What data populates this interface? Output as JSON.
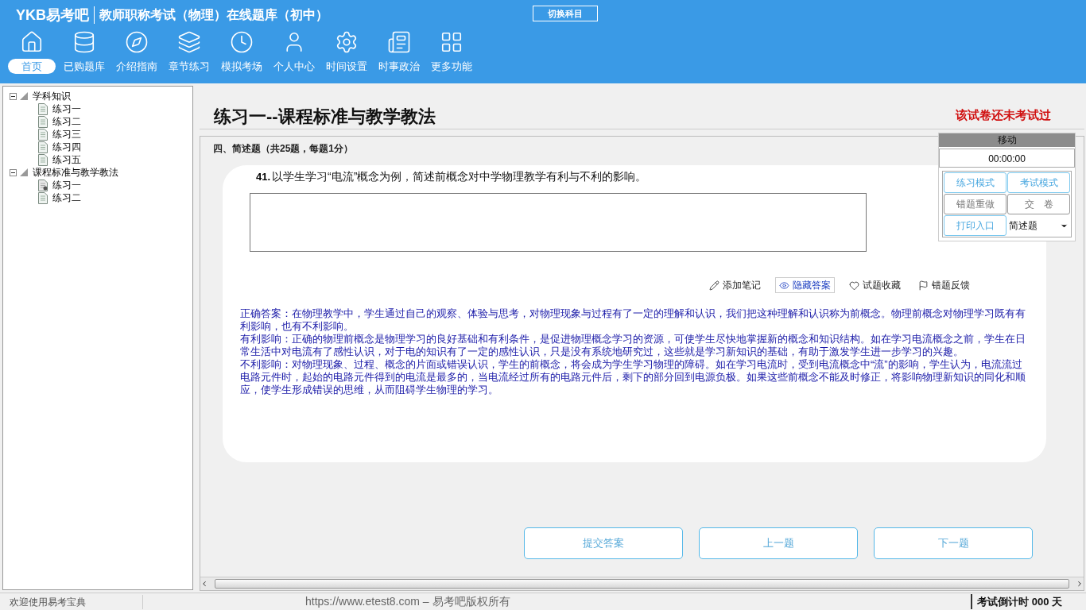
{
  "header": {
    "logo": "YKB易考吧",
    "title": "教师职称考试（物理）在线题库（初中）",
    "switch_button": "切换科目"
  },
  "nav": [
    {
      "label": "首页",
      "kind": "home",
      "selected": true
    },
    {
      "label": "已购题库",
      "kind": "database",
      "selected": false
    },
    {
      "label": "介绍指南",
      "kind": "compass",
      "selected": false
    },
    {
      "label": "章节练习",
      "kind": "layers",
      "selected": false
    },
    {
      "label": "模拟考场",
      "kind": "clock",
      "selected": false
    },
    {
      "label": "个人中心",
      "kind": "user",
      "selected": false
    },
    {
      "label": "时间设置",
      "kind": "settings",
      "selected": false
    },
    {
      "label": "时事政治",
      "kind": "news",
      "selected": false
    },
    {
      "label": "更多功能",
      "kind": "grid",
      "selected": false
    }
  ],
  "tree": [
    {
      "label": "学科知识",
      "expanded": true,
      "children": [
        {
          "label": "练习一",
          "selected": false
        },
        {
          "label": "练习二",
          "selected": false
        },
        {
          "label": "练习三",
          "selected": false
        },
        {
          "label": "练习四",
          "selected": false
        },
        {
          "label": "练习五",
          "selected": false
        }
      ]
    },
    {
      "label": "课程标准与教学教法",
      "expanded": true,
      "children": [
        {
          "label": "练习一",
          "selected": true
        },
        {
          "label": "练习二",
          "selected": false
        }
      ]
    }
  ],
  "exam": {
    "title": "练习一--课程标准与教学教法",
    "status": "该试卷还未考试过",
    "section": "四、简述题（共25题，每题1分）",
    "question": {
      "number": "41.",
      "text": "以学生学习“电流”概念为例，简述前概念对中学物理教学有利与不利的影响。"
    },
    "tools": [
      {
        "label": "添加笔记",
        "kind": "pencil",
        "selected": false
      },
      {
        "label": "隐藏答案",
        "kind": "eye",
        "selected": true
      },
      {
        "label": "试题收藏",
        "kind": "heart",
        "selected": false
      },
      {
        "label": "错题反馈",
        "kind": "flag",
        "selected": false
      }
    ],
    "answer": [
      "正确答案：在物理教学中，学生通过自己的观察、体验与思考，对物理现象与过程有了一定的理解和认识，我们把这种理解和认识称为前概念。物理前概念对物理学习既有有利影响，也有不利影响。",
      "有利影响：正确的物理前概念是物理学习的良好基础和有利条件，是促进物理概念学习的资源，可使学生尽快地掌握新的概念和知识结构。如在学习电流概念之前，学生在日常生活中对电流有了感性认识，对于电的知识有了一定的感性认识，只是没有系统地研究过，这些就是学习新知识的基础，有助于激发学生进一步学习的兴趣。",
      "不利影响：对物理现象、过程、概念的片面或错误认识，学生的前概念，将会成为学生学习物理的障碍。如在学习电流时，受到电流概念中“流”的影响，学生认为，电流流过电路元件时，起始的电路元件得到的电流是最多的，当电流经过所有的电路元件后，剩下的部分回到电源负极。如果这些前概念不能及时修正，将影响物理新知识的同化和顺应，使学生形成错误的思维，从而阻碍学生物理的学习。"
    ],
    "buttons": [
      "提交答案",
      "上一题",
      "下一题"
    ]
  },
  "panel": {
    "header": "移动",
    "timer": "00:00:00",
    "buttons": [
      {
        "label": "练习模式",
        "disabled": false
      },
      {
        "label": "考试模式",
        "disabled": false
      },
      {
        "label": "错题重做",
        "disabled": true
      },
      {
        "label": "交　卷",
        "disabled": true
      },
      {
        "label": "打印入口",
        "disabled": false
      }
    ],
    "select": "简述题"
  },
  "status_bar": {
    "welcome": "欢迎使用易考宝典",
    "copyright": "https://www.etest8.com – 易考吧版权所有",
    "countdown": "考试倒计时 000 天"
  }
}
